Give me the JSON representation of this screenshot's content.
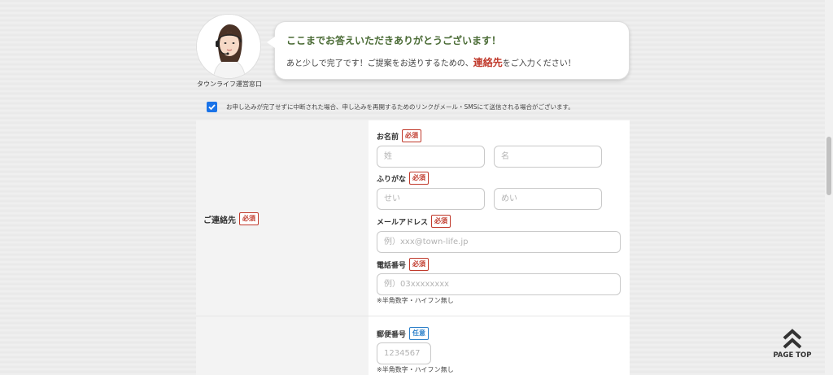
{
  "operator": {
    "label": "タウンライフ運営窓口"
  },
  "message": {
    "title": "ここまでお答えいただきありがとうございます！",
    "line_before": "あと少しで完了です！ご提案をお送りするための、",
    "line_strong": "連絡先",
    "line_after": "をご入力ください！"
  },
  "consent": {
    "checked": true,
    "text": "お申し込みが完了せずに中断された場合、申し込みを再開するためのリンクがメール・SMSにて送信される場合がございます。"
  },
  "badges": {
    "required": "必須",
    "optional": "任意"
  },
  "contact_section": {
    "label": "ご連絡先",
    "name": {
      "label": "お名前",
      "last_placeholder": "姓",
      "first_placeholder": "名"
    },
    "furigana": {
      "label": "ふりがな",
      "last_placeholder": "せい",
      "first_placeholder": "めい"
    },
    "email": {
      "label": "メールアドレス",
      "placeholder": "例）xxx@town-life.jp"
    },
    "phone": {
      "label": "電話番号",
      "placeholder": "例）03xxxxxxxx",
      "note": "※半角数字・ハイフン無し"
    }
  },
  "postal_section": {
    "label": "郵便番号",
    "placeholder": "1234567",
    "note": "※半角数字・ハイフン無し"
  },
  "page_top": {
    "label": "PAGE TOP"
  }
}
